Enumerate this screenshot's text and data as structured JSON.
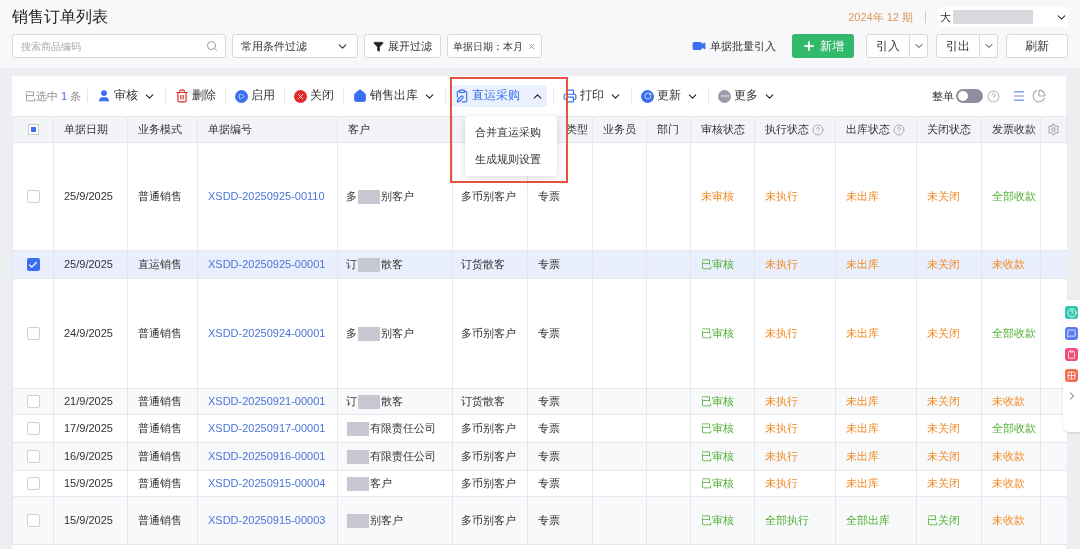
{
  "header": {
    "title": "销售订单列表",
    "period": "2024年 12 期",
    "company_visible": "大"
  },
  "filters": {
    "search_placeholder": "搜索商品编码",
    "preset": "常用条件过滤",
    "expand": "展开过滤",
    "tag": "单据日期：本月"
  },
  "actions": {
    "batch_import": "单据批量引入",
    "add": "新增",
    "import": "引入",
    "export": "引出",
    "refresh": "刷新"
  },
  "toolbar": {
    "selected_prefix": "已选中",
    "selected_count": "1",
    "selected_suffix": "条",
    "items": [
      {
        "kind": "audit",
        "label": "审核",
        "dropdown": true,
        "expanded": false,
        "selected": false
      },
      {
        "kind": "delete",
        "label": "删除",
        "dropdown": false,
        "selected": false
      },
      {
        "kind": "enable",
        "label": "启用",
        "dropdown": false,
        "selected": false
      },
      {
        "kind": "close",
        "label": "关闭",
        "dropdown": false,
        "selected": false
      },
      {
        "kind": "outbound",
        "label": "销售出库",
        "dropdown": true,
        "expanded": false,
        "selected": false
      },
      {
        "kind": "purchase",
        "label": "直运采购",
        "dropdown": true,
        "expanded": true,
        "selected": true
      },
      {
        "kind": "print",
        "label": "打印",
        "dropdown": true,
        "expanded": false,
        "selected": false
      },
      {
        "kind": "update",
        "label": "更新",
        "dropdown": true,
        "expanded": false,
        "selected": false
      },
      {
        "kind": "more",
        "label": "更多",
        "dropdown": true,
        "expanded": false,
        "selected": false
      }
    ],
    "whole_label": "整单",
    "whole_on": false
  },
  "menu": [
    "合并直运采购",
    "生成规则设置"
  ],
  "select_all_partial": true,
  "columns": [
    {
      "label": "单据日期",
      "help": false
    },
    {
      "label": "业务模式",
      "help": false
    },
    {
      "label": "单据编号",
      "help": false
    },
    {
      "label": "客户",
      "help": false
    },
    {
      "help": false
    },
    {
      "label": "类型",
      "help": false
    },
    {
      "label": "业务员",
      "help": false
    },
    {
      "label": "部门",
      "help": false
    },
    {
      "label": "审核状态",
      "help": false
    },
    {
      "label": "执行状态",
      "help": true
    },
    {
      "label": "出库状态",
      "help": true
    },
    {
      "label": "关闭状态",
      "help": false
    },
    {
      "label": "发票收款",
      "help": false
    }
  ],
  "rows": [
    {
      "selected": false,
      "date": "25/9/2025",
      "mode": "普通销售",
      "number": "XSDD-20250925-00110",
      "customer_before": "多",
      "customer_after": "别客户",
      "customer_type": "多币别客户",
      "invoice": "专票",
      "statuses": [
        {
          "text": "未审核",
          "done": false
        },
        {
          "text": "未执行",
          "done": false
        },
        {
          "text": "未出库",
          "done": false
        },
        {
          "text": "未关闭",
          "done": false
        },
        {
          "text": "全部收款",
          "done": true
        }
      ]
    },
    {
      "selected": true,
      "date": "25/9/2025",
      "mode": "直运销售",
      "number": "XSDD-20250925-00001",
      "customer_before": "订",
      "customer_after": "散客",
      "customer_type": "订货散客",
      "invoice": "专票",
      "statuses": [
        {
          "text": "已审核",
          "done": true
        },
        {
          "text": "未执行",
          "done": false
        },
        {
          "text": "未出库",
          "done": false
        },
        {
          "text": "未关闭",
          "done": false
        },
        {
          "text": "未收款",
          "done": false
        }
      ]
    },
    {
      "selected": false,
      "date": "24/9/2025",
      "mode": "普通销售",
      "number": "XSDD-20250924-00001",
      "customer_before": "多",
      "customer_after": "别客户",
      "customer_type": "多币别客户",
      "invoice": "专票",
      "statuses": [
        {
          "text": "已审核",
          "done": true
        },
        {
          "text": "未执行",
          "done": false
        },
        {
          "text": "未出库",
          "done": false
        },
        {
          "text": "未关闭",
          "done": false
        },
        {
          "text": "全部收款",
          "done": true
        }
      ]
    },
    {
      "selected": false,
      "date": "21/9/2025",
      "mode": "普通销售",
      "number": "XSDD-20250921-00001",
      "customer_before": "订",
      "customer_after": "散客",
      "customer_type": "订货散客",
      "invoice": "专票",
      "statuses": [
        {
          "text": "已审核",
          "done": true
        },
        {
          "text": "未执行",
          "done": false
        },
        {
          "text": "未出库",
          "done": false
        },
        {
          "text": "未关闭",
          "done": false
        },
        {
          "text": "未收款",
          "done": false
        }
      ]
    },
    {
      "selected": false,
      "date": "17/9/2025",
      "mode": "普通销售",
      "number": "XSDD-20250917-00001",
      "customer_after": "有限责任公司",
      "customer_type": "多币别客户",
      "invoice": "专票",
      "statuses": [
        {
          "text": "已审核",
          "done": true
        },
        {
          "text": "未执行",
          "done": false
        },
        {
          "text": "未出库",
          "done": false
        },
        {
          "text": "未关闭",
          "done": false
        },
        {
          "text": "全部收款",
          "done": true
        }
      ]
    },
    {
      "selected": false,
      "date": "16/9/2025",
      "mode": "普通销售",
      "number": "XSDD-20250916-00001",
      "customer_after": "有限责任公司",
      "customer_type": "多币别客户",
      "invoice": "专票",
      "statuses": [
        {
          "text": "已审核",
          "done": true
        },
        {
          "text": "未执行",
          "done": false
        },
        {
          "text": "未出库",
          "done": false
        },
        {
          "text": "未关闭",
          "done": false
        },
        {
          "text": "未收款",
          "done": false
        }
      ]
    },
    {
      "selected": false,
      "date": "15/9/2025",
      "mode": "普通销售",
      "number": "XSDD-20250915-00004",
      "customer_after": "客户",
      "customer_type": "多币别客户",
      "invoice": "专票",
      "statuses": [
        {
          "text": "已审核",
          "done": true
        },
        {
          "text": "未执行",
          "done": false
        },
        {
          "text": "未出库",
          "done": false
        },
        {
          "text": "未关闭",
          "done": false
        },
        {
          "text": "未收款",
          "done": false
        }
      ]
    },
    {
      "selected": false,
      "date": "15/9/2025",
      "mode": "普通销售",
      "number": "XSDD-20250915-00003",
      "customer_after": "别客户",
      "customer_type": "多币别客户",
      "invoice": "专票",
      "statuses": [
        {
          "text": "已审核",
          "done": true
        },
        {
          "text": "全部执行",
          "done": true
        },
        {
          "text": "全部出库",
          "done": true
        },
        {
          "text": "已关闭",
          "done": true
        },
        {
          "text": "未收款",
          "done": false
        }
      ]
    }
  ]
}
